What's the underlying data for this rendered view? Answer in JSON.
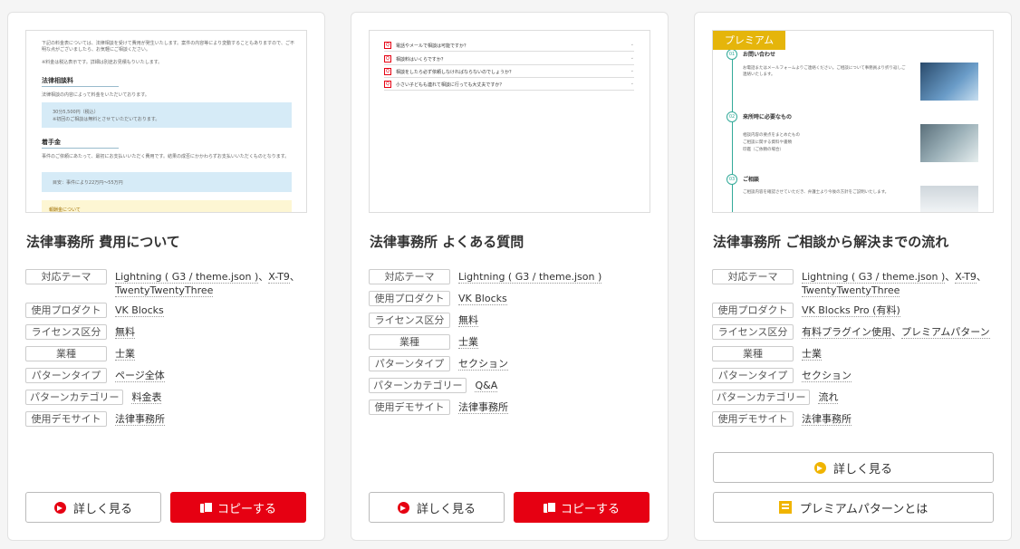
{
  "cards": [
    {
      "title": "法律事務所 費用について",
      "thumb": {
        "intro1": "下記の料金表については、法律相談を受けて費用が発生いたします。案件の内容等により変動することもありますので、ご不明な点がございましたら、お気軽にご相談ください。",
        "intro2": "※料金は税込表示です。詳細は別途お見積もりいたします。",
        "h1": "法律相談料",
        "p1": "法律相談の内容によって料金をいただいております。",
        "box1a": "30分5,500円（税込）",
        "box1b": "※初回のご相談は無料とさせていただいております。",
        "h2": "着手金",
        "p2": "事件のご依頼にあたって、最初にお支払いいただく費用です。結果の成否にかかわらずお支払いいただくものとなります。",
        "box2": "目安：事件により22万円〜55万円",
        "note": "報酬金について"
      },
      "meta": [
        {
          "label": "対応テーマ",
          "values": [
            "Lightning ( G3 / theme.json )",
            "X-T9",
            "TwentyTwentyThree"
          ]
        },
        {
          "label": "使用プロダクト",
          "values": [
            "VK Blocks"
          ]
        },
        {
          "label": "ライセンス区分",
          "values": [
            "無料"
          ]
        },
        {
          "label": "業種",
          "values": [
            "士業"
          ]
        },
        {
          "label": "パターンタイプ",
          "values": [
            "ページ全体"
          ]
        },
        {
          "label": "パターンカテゴリー",
          "values": [
            "料金表"
          ]
        },
        {
          "label": "使用デモサイト",
          "values": [
            "法律事務所"
          ]
        }
      ],
      "buttons": {
        "detail": "詳しく見る",
        "copy": "コピーする"
      }
    },
    {
      "title": "法律事務所 よくある質問",
      "thumb": {
        "faqs": [
          "電話やメールで相談は可能ですか？",
          "相談料はいくらですか？",
          "相談をしたら必ず依頼しなければならないのでしょうか？",
          "小さい子どもも連れて相談に行っても大丈夫ですか？"
        ],
        "q": "Q"
      },
      "meta": [
        {
          "label": "対応テーマ",
          "values": [
            "Lightning ( G3 / theme.json )"
          ]
        },
        {
          "label": "使用プロダクト",
          "values": [
            "VK Blocks"
          ]
        },
        {
          "label": "ライセンス区分",
          "values": [
            "無料"
          ]
        },
        {
          "label": "業種",
          "values": [
            "士業"
          ]
        },
        {
          "label": "パターンタイプ",
          "values": [
            "セクション"
          ]
        },
        {
          "label": "パターンカテゴリー",
          "values": [
            "Q&A"
          ]
        },
        {
          "label": "使用デモサイト",
          "values": [
            "法律事務所"
          ]
        }
      ],
      "buttons": {
        "detail": "詳しく見る",
        "copy": "コピーする"
      }
    },
    {
      "title": "法律事務所 ご相談から解決までの流れ",
      "thumb": {
        "badge": "プレミアム",
        "s1": "お問い合わせ",
        "s1p": "お電話またはメールフォームよりご連絡ください。ご相談について事務員より折り返しご連絡いたします。",
        "s2": "来所時に必要なもの",
        "s2a": "相談内容の要点をまとめたもの",
        "s2b": "ご相談に関する資料や書類",
        "s2c": "印鑑（ご依頼の場合）",
        "s3": "ご相談",
        "s3p": "ご相談内容を確認させていただき、弁護士より今後の方針をご説明いたします。",
        "n1": "01",
        "n2": "02",
        "n3": "03"
      },
      "meta": [
        {
          "label": "対応テーマ",
          "values": [
            "Lightning ( G3 / theme.json )",
            "X-T9",
            "TwentyTwentyThree"
          ]
        },
        {
          "label": "使用プロダクト",
          "values": [
            "VK Blocks Pro (有料)"
          ]
        },
        {
          "label": "ライセンス区分",
          "values": [
            "有料プラグイン使用",
            "プレミアムパターン"
          ]
        },
        {
          "label": "業種",
          "values": [
            "士業"
          ]
        },
        {
          "label": "パターンタイプ",
          "values": [
            "セクション"
          ]
        },
        {
          "label": "パターンカテゴリー",
          "values": [
            "流れ"
          ]
        },
        {
          "label": "使用デモサイト",
          "values": [
            "法律事務所"
          ]
        }
      ],
      "buttons": {
        "detail": "詳しく見る",
        "premium": "プレミアムパターンとは"
      }
    }
  ],
  "colors": {
    "accent": "#e60012",
    "premium": "#e5b50b"
  }
}
